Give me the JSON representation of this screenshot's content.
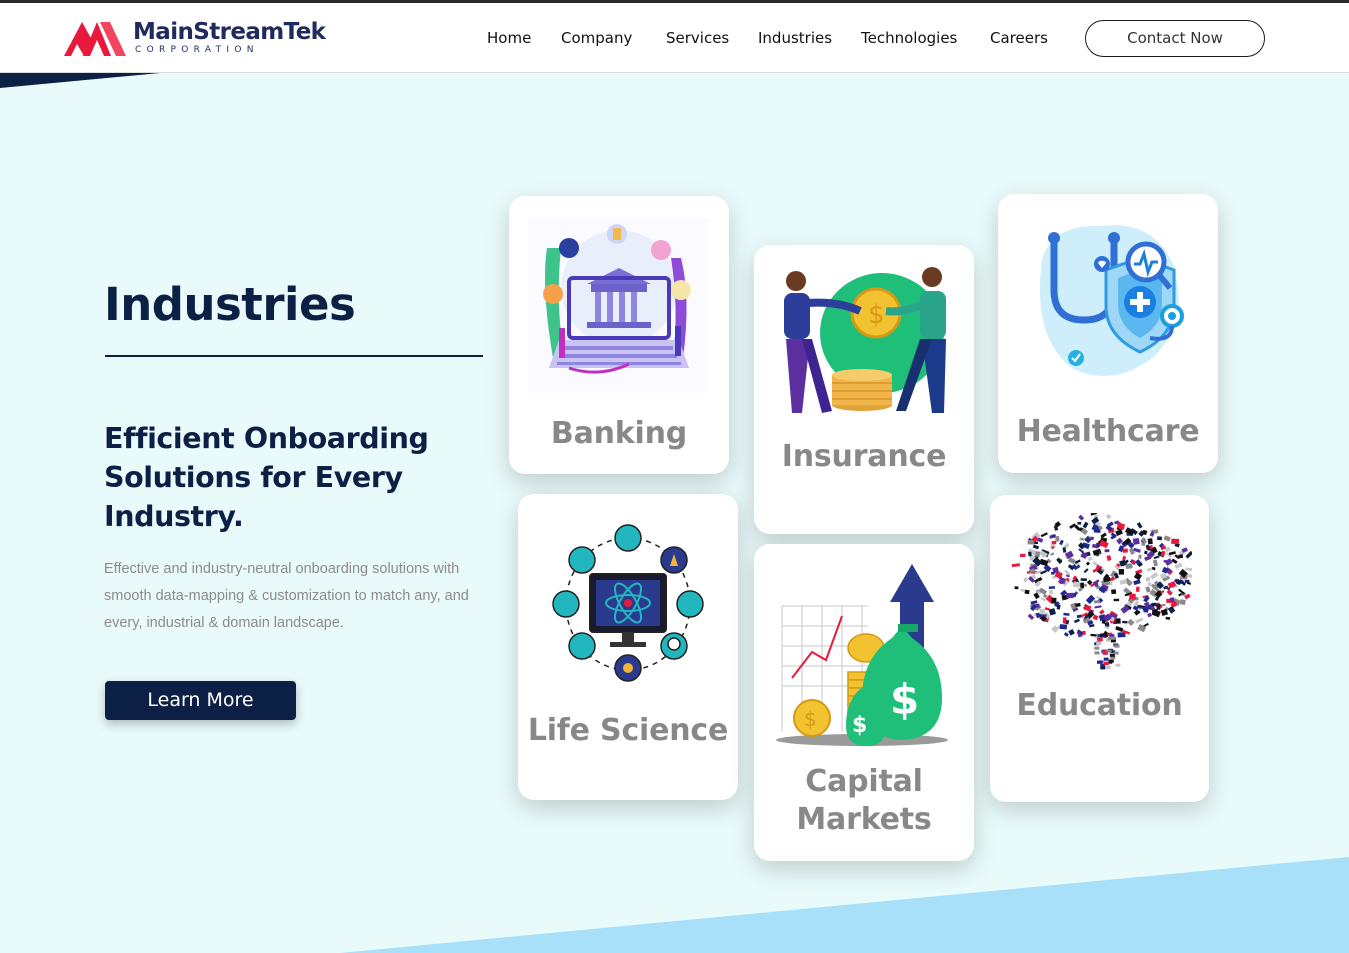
{
  "brand": {
    "name": "MainStreamTek",
    "sub": "CORPORATION",
    "colors": {
      "navy": "#1f2b5c",
      "red": "#e8193c",
      "pink": "#f2465f"
    }
  },
  "nav": {
    "items": [
      "Home",
      "Company",
      "Services",
      "Industries",
      "Technologies",
      "Careers"
    ],
    "contact_label": "Contact Now"
  },
  "hero": {
    "title": "Industries",
    "subtitle": "Efficient Onboarding Solutions for Every Industry.",
    "body": "Effective and industry-neutral onboarding solutions with smooth data-mapping & customization to match any, and every, industrial & domain landscape.",
    "cta_label": "Learn More"
  },
  "industries": [
    {
      "label": "Banking",
      "icon": "bank-laptop-illustration"
    },
    {
      "label": "Insurance",
      "icon": "coin-handshake-illustration"
    },
    {
      "label": "Healthcare",
      "icon": "stethoscope-shield-illustration"
    },
    {
      "label": "Life Science",
      "icon": "science-monitor-illustration"
    },
    {
      "label": "Capital Markets",
      "icon": "money-growth-illustration"
    },
    {
      "label": "Education",
      "icon": "brain-books-illustration"
    }
  ],
  "colors": {
    "background": "#e9fafa",
    "text_dark": "#0c1f45",
    "card_label": "#888888",
    "wedge_blue": "#a9e0f9"
  }
}
